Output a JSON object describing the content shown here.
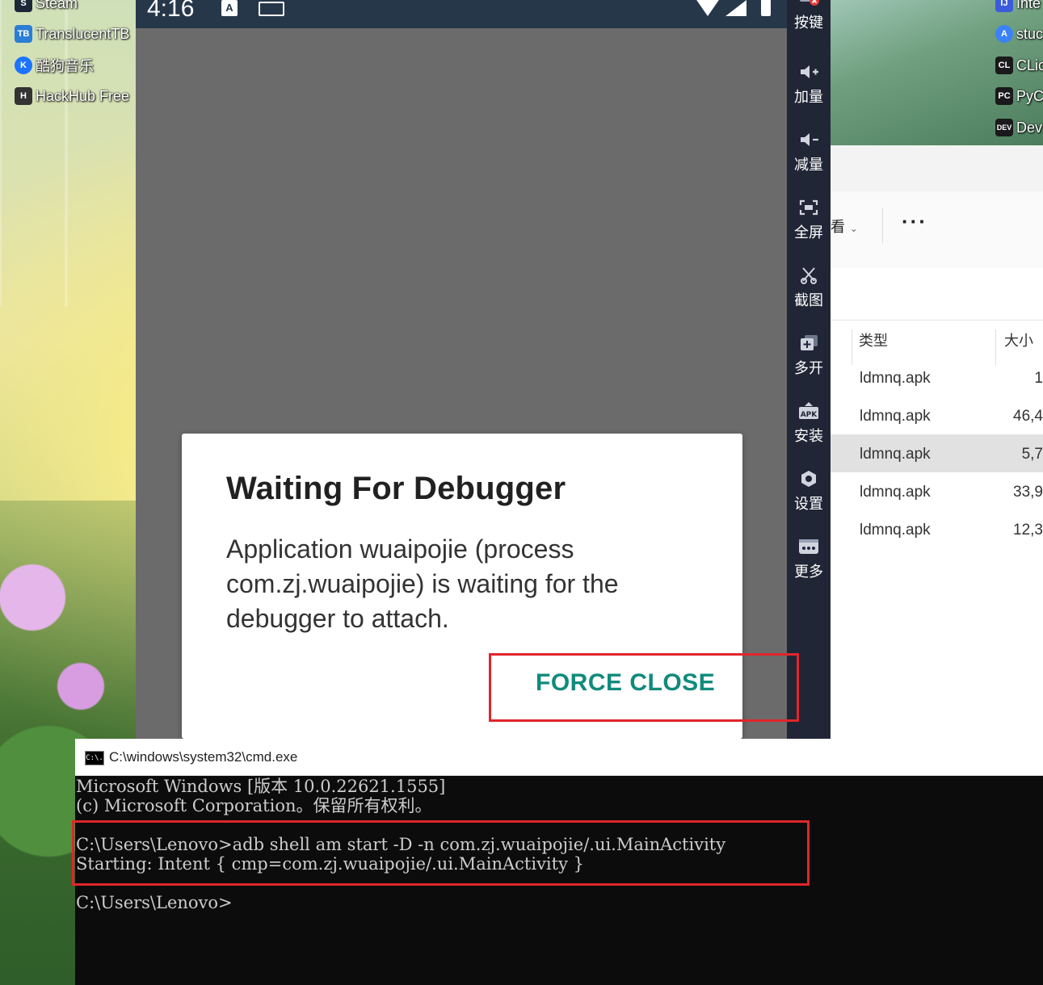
{
  "desktop": {
    "left_icons": [
      {
        "label": "Steam",
        "icon": "steam-icon",
        "color": "#1b2838"
      },
      {
        "label": "TranslucentTB",
        "icon": "translucenttb-icon",
        "color": "#2a7fd4"
      },
      {
        "label": "酷狗音乐",
        "icon": "kugou-icon",
        "color": "#1c73ff"
      },
      {
        "label": "HackHub Free",
        "icon": "hackhub-icon",
        "color": "#333333"
      }
    ],
    "right_icons": [
      {
        "label": "Inte",
        "icon": "intellij-icon",
        "color": "#3b5bdb"
      },
      {
        "label": "stuc",
        "icon": "android-studio-icon",
        "color": "#3b82f6"
      },
      {
        "label": "CLic",
        "icon": "clion-icon",
        "color": "#1a1a1a"
      },
      {
        "label": "PyC",
        "icon": "pycharm-icon",
        "color": "#1a1a1a"
      },
      {
        "label": "Dev",
        "icon": "devcpp-icon",
        "color": "#1a1a1a"
      }
    ]
  },
  "emulator": {
    "status_time": "4:16",
    "status_a_icon": "A",
    "dialog": {
      "title": "Waiting For Debugger",
      "message": "Application wuaipojie (process com.zj.wuaipojie) is waiting for the debugger to attach.",
      "button": "FORCE CLOSE"
    },
    "sidebar": [
      {
        "label": "按键",
        "icon": "keymap-icon"
      },
      {
        "label": "加量",
        "icon": "volume-up-icon"
      },
      {
        "label": "减量",
        "icon": "volume-down-icon"
      },
      {
        "label": "全屏",
        "icon": "fullscreen-icon"
      },
      {
        "label": "截图",
        "icon": "screenshot-icon"
      },
      {
        "label": "多开",
        "icon": "multi-instance-icon"
      },
      {
        "label": "安装",
        "icon": "install-apk-icon"
      },
      {
        "label": "设置",
        "icon": "settings-icon"
      },
      {
        "label": "更多",
        "icon": "more-icon"
      }
    ]
  },
  "explorer": {
    "view_label": "看",
    "more_label": "···",
    "columns": {
      "type": "类型",
      "size": "大小"
    },
    "rows": [
      {
        "type": "ldmnq.apk",
        "size": "1"
      },
      {
        "type": "ldmnq.apk",
        "size": "46,4"
      },
      {
        "type": "ldmnq.apk",
        "size": "5,7"
      },
      {
        "type": "ldmnq.apk",
        "size": "33,9"
      },
      {
        "type": "ldmnq.apk",
        "size": "12,3"
      }
    ],
    "selected_row": 2
  },
  "cmd": {
    "title": "C:\\windows\\system32\\cmd.exe",
    "icon_text": "C:\\.",
    "lines": [
      "Microsoft Windows [版本 10.0.22621.1555]",
      "(c) Microsoft Corporation。保留所有权利。",
      "",
      "C:\\Users\\Lenovo>adb shell am start -D -n com.zj.wuaipojie/.ui.MainActivity",
      "Starting: Intent { cmp=com.zj.wuaipojie/.ui.MainActivity }",
      "",
      "C:\\Users\\Lenovo>"
    ]
  },
  "colors": {
    "accent_teal": "#108a7c",
    "highlight_red": "#e0262b",
    "emulator_sidebar": "#202636",
    "status_bar": "#26374a"
  }
}
